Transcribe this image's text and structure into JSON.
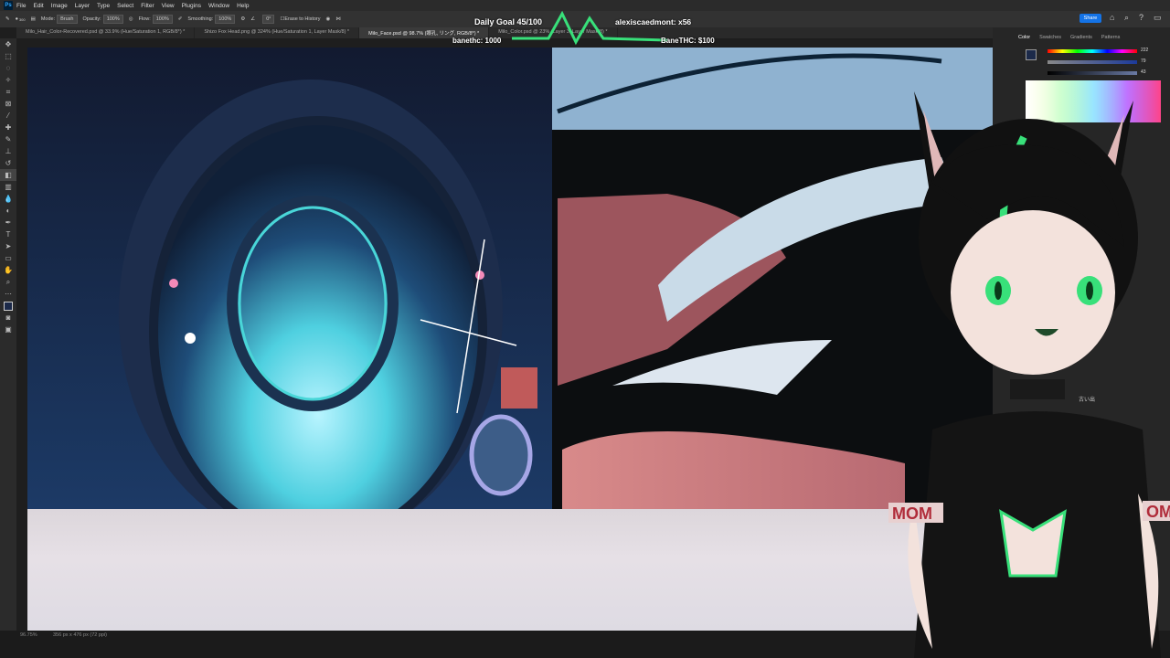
{
  "app": {
    "logo": "Ps"
  },
  "menu": [
    "File",
    "Edit",
    "Image",
    "Layer",
    "Type",
    "Select",
    "Filter",
    "View",
    "Plugins",
    "Window",
    "Help"
  ],
  "options": {
    "mode_label": "Mode:",
    "mode_value": "Brush",
    "opacity_label": "Opacity:",
    "opacity_value": "100%",
    "flow_label": "Flow:",
    "flow_value": "100%",
    "smoothing_label": "Smoothing:",
    "smoothing_value": "100%",
    "angle_value": "0°",
    "erase_history": "Erase to History",
    "brush_size": "300"
  },
  "share_label": "Share",
  "tabs": [
    {
      "label": "Milo_Hair_Color-Recovered.psd @ 33.9% (Hue/Saturation 1, RGB/8*) *",
      "active": false
    },
    {
      "label": "Shizo Fox Head.png @ 324% (Hue/Saturation 1, Layer Mask/8) *",
      "active": false
    },
    {
      "label": "Milo_Face.psd @ 98.7% (眼孔, リング, RGB/8*) *",
      "active": true
    },
    {
      "label": "Milo_Color.psd @ 23% (Layer 3, Layer Mask/8) *",
      "active": false
    }
  ],
  "right_panel": {
    "tabs": [
      "Color",
      "Swatches",
      "Gradients",
      "Patterns"
    ],
    "values": [
      "222",
      "79",
      "43"
    ],
    "subtext": "古い出"
  },
  "overlay": {
    "goal": "Daily Goal 45/100",
    "top_user": "alexiscaedmont: x56",
    "bane1": "banethc: 1000",
    "bane2": "BaneTHC: $100"
  },
  "status": {
    "zoom": "96.75%",
    "doc": "356 px x 476 px (72 ppi)"
  },
  "avatar": {
    "armband": "MOM",
    "armband2": "OM"
  },
  "colors": {
    "accent": "#1473e6",
    "green": "#38e07a",
    "cyan": "#38e6e0"
  },
  "icons": [
    "move-icon",
    "marquee-icon",
    "lasso-icon",
    "quick-select-icon",
    "crop-icon",
    "frame-icon",
    "eyedropper-icon",
    "healing-icon",
    "brush-icon",
    "stamp-icon",
    "history-brush-icon",
    "eraser-icon",
    "gradient-icon",
    "blur-icon",
    "dodge-icon",
    "pen-icon",
    "type-icon",
    "path-select-icon",
    "shape-icon",
    "hand-icon",
    "zoom-icon",
    "more-icon",
    "foreground-color-icon",
    "quick-mask-icon",
    "screen-mode-icon"
  ]
}
